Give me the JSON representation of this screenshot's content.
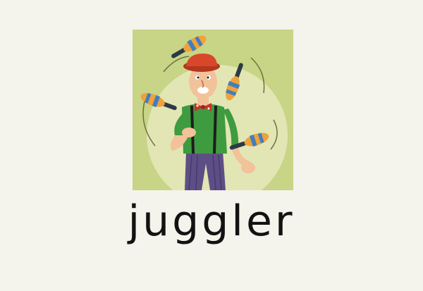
{
  "flashcard": {
    "word": "juggler",
    "illustration": "juggler-illustration",
    "colors": {
      "page_background": "#f4f3ec",
      "card_background": "#c8d486",
      "halo": "#e2e6b4",
      "shirt": "#3f9b3f",
      "hat": "#d9472b",
      "trousers": "#5d4f86",
      "bowtie": "#c8302a",
      "pin_orange": "#f0a23a",
      "pin_blue": "#3f7fbf"
    }
  }
}
